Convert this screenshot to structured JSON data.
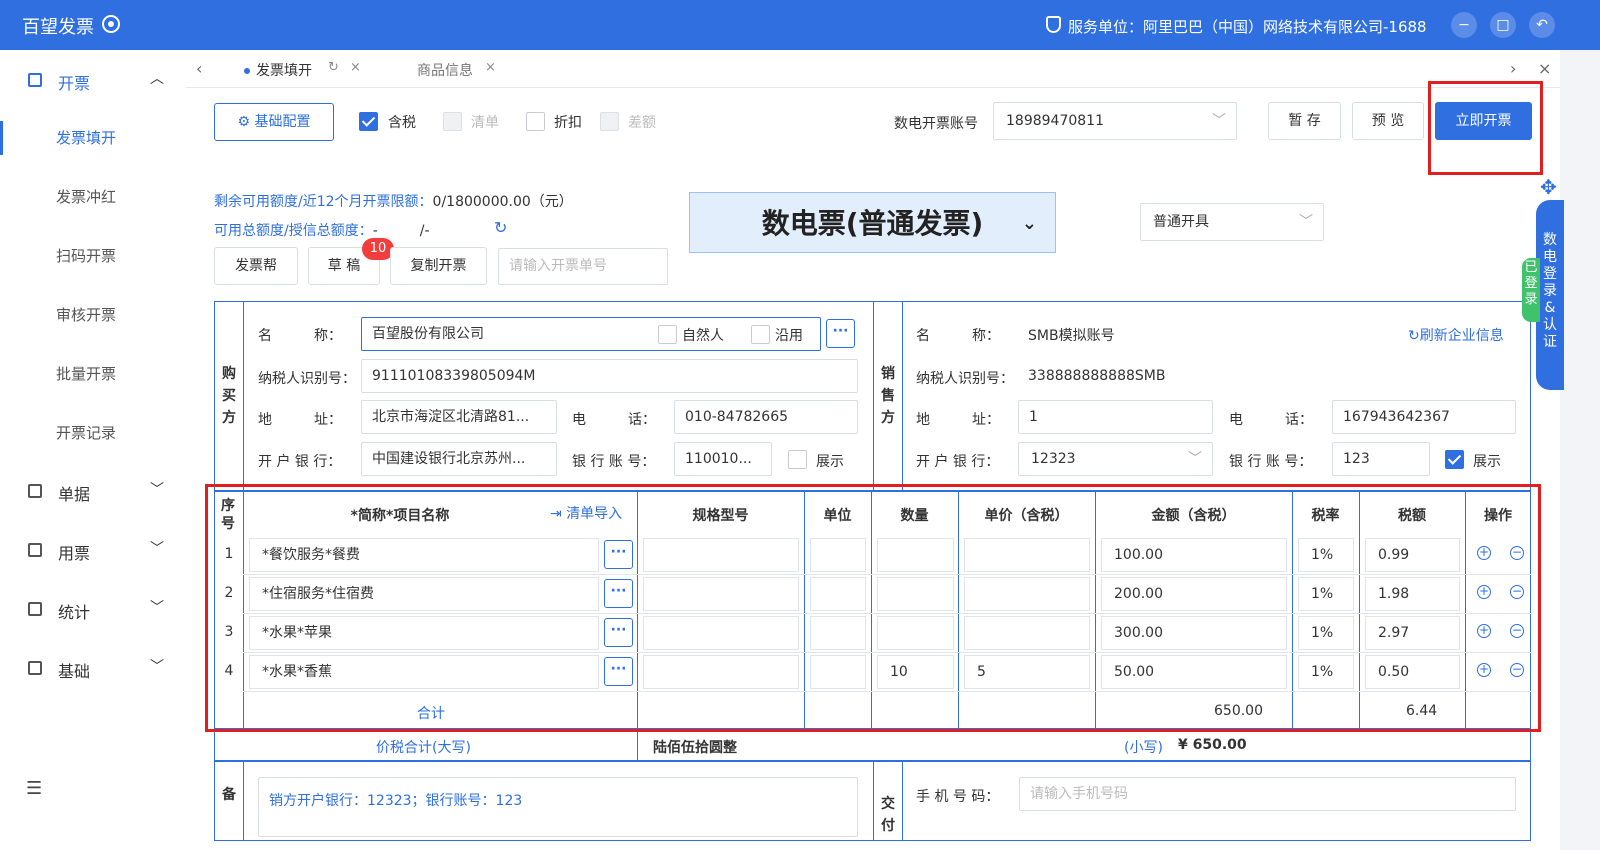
{
  "app": {
    "title": "百望发票",
    "service_unit": "服务单位：阿里巴巴（中国）网络技术有限公司-1688"
  },
  "window_buttons": [
    "−",
    "□",
    "↶"
  ],
  "sidebar": {
    "groups": [
      {
        "label": "开票",
        "open": true,
        "icon": "invoice-icon",
        "items": [
          "发票填开",
          "发票冲红",
          "扫码开票",
          "审核开票",
          "批量开票",
          "开票记录"
        ],
        "active": "发票填开"
      },
      {
        "label": "单据",
        "icon": "document-icon"
      },
      {
        "label": "用票",
        "icon": "ticket-icon"
      },
      {
        "label": "统计",
        "icon": "chart-icon"
      },
      {
        "label": "基础",
        "icon": "base-icon"
      }
    ],
    "menu_toggle": "☰"
  },
  "tabs": [
    {
      "label": "发票填开",
      "active": true
    },
    {
      "label": "商品信息",
      "active": false
    }
  ],
  "toolbar": {
    "config": "基础配置",
    "options": [
      {
        "label": "含税",
        "checked": true,
        "disabled": false
      },
      {
        "label": "清单",
        "checked": false,
        "disabled": true
      },
      {
        "label": "折扣",
        "checked": false,
        "disabled": false
      },
      {
        "label": "差额",
        "checked": false,
        "disabled": true
      }
    ],
    "account_label": "数电开票账号",
    "account_value": "18989470811",
    "save": "暂 存",
    "preview": "预 览",
    "issue": "立即开票"
  },
  "quota": {
    "line1_label": "剩余可用额度/近12个月开票限额：",
    "line1_value": "0/1800000.00（元）",
    "line2_label": "可用总额度/授信总额度：",
    "line2_value": "-　　　/-"
  },
  "invoice_type": "数电票(普通发票)",
  "issue_mode": "普通开具",
  "actions": {
    "help": "发票帮",
    "draft": "草 稿",
    "draft_count": "10",
    "copy": "复制开票",
    "number_placeholder": "请输入开票单号"
  },
  "buyer": {
    "side_label": "购买方",
    "name_label": "名　　　称：",
    "name": "百望股份有限公司",
    "natural_person": "自然人",
    "reuse": "沿用",
    "tax_id_label": "纳税人识别号：",
    "tax_id": "91110108339805094M",
    "address_label": "地　　　址：",
    "address": "北京市海淀区北清路81...",
    "phone_label": "电　　　话：",
    "phone": "010-84782665",
    "bank_label": "开 户 银 行：",
    "bank": "中国建设银行北京苏州...",
    "account_label": "银 行 账 号：",
    "account": "110010...",
    "show": "展示"
  },
  "seller": {
    "side_label": "销售方",
    "name_label": "名　　　称：",
    "name": "SMB模拟账号",
    "refresh": "刷新企业信息",
    "tax_id_label": "纳税人识别号：",
    "tax_id": "338888888888SMB",
    "address_label": "地　　　址：",
    "address": "1",
    "phone_label": "电　　　话：",
    "phone": "167943642367",
    "bank_label": "开 户 银 行：",
    "bank": "12323",
    "account_label": "银 行 账 号：",
    "account": "123",
    "show": "展示"
  },
  "items_table": {
    "headers": {
      "seq": "序号",
      "name": "*简称*项目名称",
      "import": "清单导入",
      "spec": "规格型号",
      "unit": "单位",
      "qty": "数量",
      "price": "单价（含税）",
      "amount": "金额（含税）",
      "rate": "税率",
      "tax": "税额",
      "op": "操作"
    },
    "rows": [
      {
        "seq": "1",
        "name": "*餐饮服务*餐费",
        "spec": "",
        "unit": "",
        "qty": "",
        "price": "",
        "amount": "100.00",
        "rate": "1%",
        "tax": "0.99"
      },
      {
        "seq": "2",
        "name": "*住宿服务*住宿费",
        "spec": "",
        "unit": "",
        "qty": "",
        "price": "",
        "amount": "200.00",
        "rate": "1%",
        "tax": "1.98"
      },
      {
        "seq": "3",
        "name": "*水果*苹果",
        "spec": "",
        "unit": "",
        "qty": "",
        "price": "",
        "amount": "300.00",
        "rate": "1%",
        "tax": "2.97"
      },
      {
        "seq": "4",
        "name": "*水果*香蕉",
        "spec": "",
        "unit": "",
        "qty": "10",
        "price": "5",
        "amount": "50.00",
        "rate": "1%",
        "tax": "0.50"
      }
    ],
    "total_label": "合计",
    "total_amount": "650.00",
    "total_tax": "6.44"
  },
  "grand_total": {
    "label": "价税合计(大写)",
    "upper": "陆佰伍拾圆整",
    "small_label": "(小写)",
    "small": "¥ 650.00"
  },
  "remark": {
    "side_label": "备",
    "text": "销方开户银行：12323；银行账号：123"
  },
  "delivery": {
    "side_label": "交付",
    "phone_label": "手 机 号 码：",
    "phone_placeholder": "请输入手机号码"
  },
  "side_panel": {
    "text": "数电登录&认证",
    "login_tag": "已登录"
  },
  "colors": {
    "primary": "#2f6fe0",
    "highlight": "#e02020",
    "badge": "#f23d3d",
    "login": "#40c26a"
  }
}
